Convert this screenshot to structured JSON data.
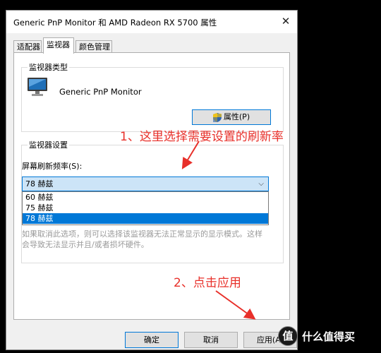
{
  "window": {
    "title": "Generic PnP Monitor 和 AMD Radeon RX 5700 属性",
    "close_glyph": "✕"
  },
  "tabs": [
    {
      "label": "适配器",
      "active": false
    },
    {
      "label": "监视器",
      "active": true
    },
    {
      "label": "颜色管理",
      "active": false
    }
  ],
  "monitor_type": {
    "legend": "监视器类型",
    "name": "Generic PnP Monitor",
    "properties_button": "属性(P)",
    "icon": "monitor-icon"
  },
  "monitor_settings": {
    "legend": "监视器设置",
    "refresh_label": "屏幕刷新频率(S):",
    "selected_value": "78 赫兹",
    "options": [
      "60 赫兹",
      "75 赫兹",
      "78 赫兹"
    ],
    "selected_index": 2,
    "warning_text": "如果取消此选项，则可以选择该监视器无法正常显示的显示模式。这样会导致无法显示并且/或者损坏硬件。"
  },
  "buttons": {
    "ok": "确定",
    "cancel": "取消",
    "apply": "应用(A)"
  },
  "annotations": {
    "step1": "1、这里选择需要设置的刷新率",
    "step2": "2、点击应用"
  },
  "watermark": {
    "logo_glyph": "值",
    "text": "什么值得买"
  },
  "colors": {
    "accent": "#0078d7",
    "annotation": "#e8302a",
    "selection": "#0078d7"
  }
}
